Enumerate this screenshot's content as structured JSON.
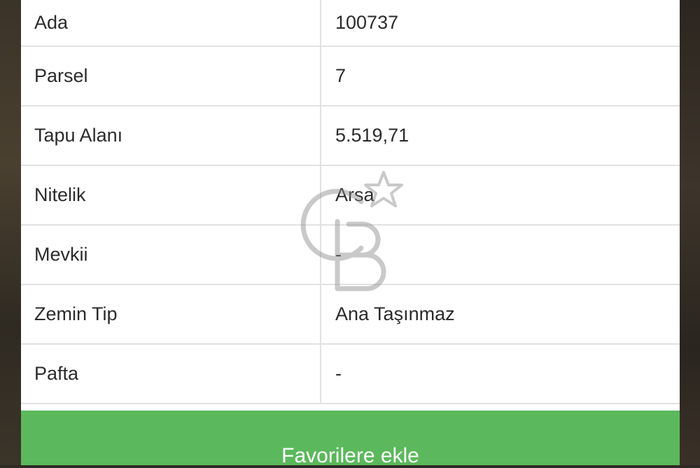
{
  "table": {
    "rows": [
      {
        "label": "Ada",
        "value": "100737"
      },
      {
        "label": "Parsel",
        "value": "7"
      },
      {
        "label": "Tapu Alanı",
        "value": "5.519,71"
      },
      {
        "label": "Nitelik",
        "value": "Arsa"
      },
      {
        "label": "Mevkii",
        "value": "-"
      },
      {
        "label": "Zemin Tip",
        "value": "Ana Taşınmaz"
      },
      {
        "label": "Pafta",
        "value": "-"
      }
    ]
  },
  "actions": {
    "favorite_label": "Favorilere ekle"
  },
  "colors": {
    "button_green": "#5cb85c",
    "divider": "#e2e2e2"
  },
  "watermark": {
    "icon": "cb-logo-icon"
  }
}
